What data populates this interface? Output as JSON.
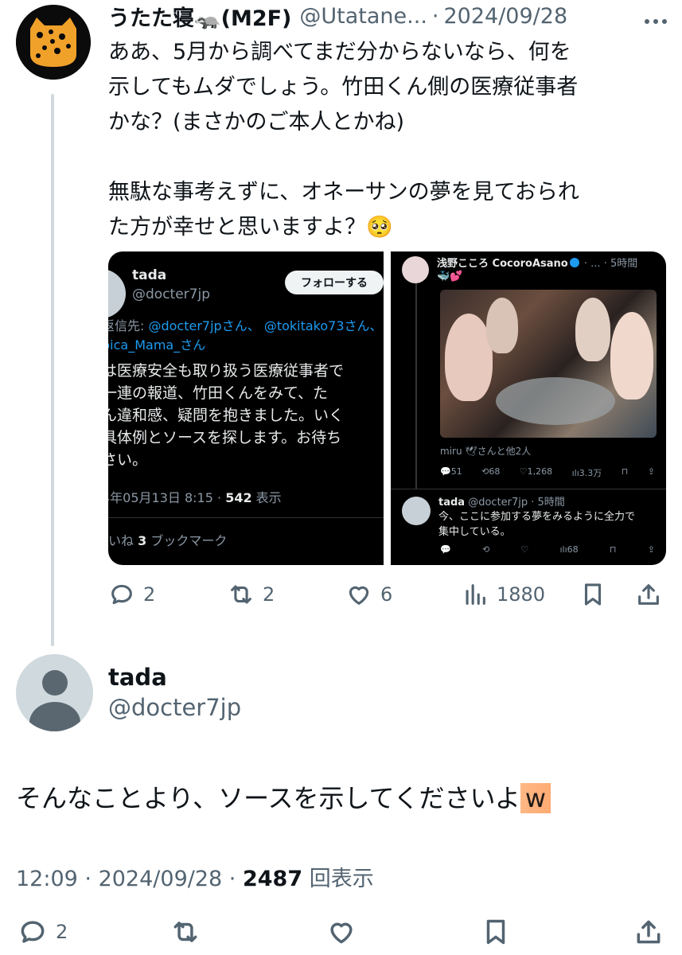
{
  "parent_tweet": {
    "display_name": "うたた寝🦡(M2F)",
    "handle_truncated": "@Utatane...",
    "separator": "·",
    "date": "2024/09/28",
    "more_icon": "ellipsis-icon",
    "text": "ああ、5月から調べてまだ分からないなら、何を\n示してもムダでしょう。竹田くん側の医療従事者\nかな？(まさかのご本人とかね)\n\n無駄な事考えずに、オネーサンの夢を見ておられ\nた方が幸せと思いますよ？🥺",
    "actions": {
      "reply_count": "2",
      "retweet_count": "2",
      "like_count": "6",
      "view_count": "1880"
    }
  },
  "media_left": {
    "name": "tada",
    "handle": "@docter7jp",
    "follow_label": "フォローする",
    "reply_prefix": "返信先: ",
    "reply_link_1": "@docter7jpさん、",
    "reply_link_2": "@tokitako73さん、",
    "reply_link_3": "pica_Mama_さん",
    "body": "は医療安全も取り扱う医療従事者で\n一連の報道、竹田くんをみて、た\nん違和感、疑問を抱きました。いく\n具体例とソースを探します。お待ち\nさい。",
    "date": "4年05月13日 8:15 · ",
    "views_number": "542",
    "views_label": " 表示",
    "likes_prefix": "いね ",
    "bookmarks_number": "3",
    "bookmarks_label": " ブックマーク"
  },
  "media_right": {
    "name": "浅野こころ CocoroAsano",
    "time": " · ... · 5時間",
    "emoji": "🐳💕",
    "with_text": "miru 🕊さんと他2人",
    "stats": [
      "💬51",
      "⟲68",
      "♡1,268",
      "ılı3.3万",
      "⊓",
      "⇪"
    ],
    "reply_name": "tada",
    "reply_meta": " @docter7jp · 5時間",
    "reply_text": "今、ここに参加する夢をみるように全力で\n集中している。",
    "reply_stats": [
      "💬",
      "⟲",
      "♡",
      "ılı68",
      "⊓",
      "⇪"
    ]
  },
  "main_tweet": {
    "display_name": "tada",
    "handle": "@docter7jp",
    "text_main": "そんなことより、ソースを示してくださいよ",
    "text_highlight": "w",
    "time": "12:09",
    "date": "2024/09/28",
    "views_number": "2487",
    "views_label": "回表示",
    "reply_count": "2"
  }
}
